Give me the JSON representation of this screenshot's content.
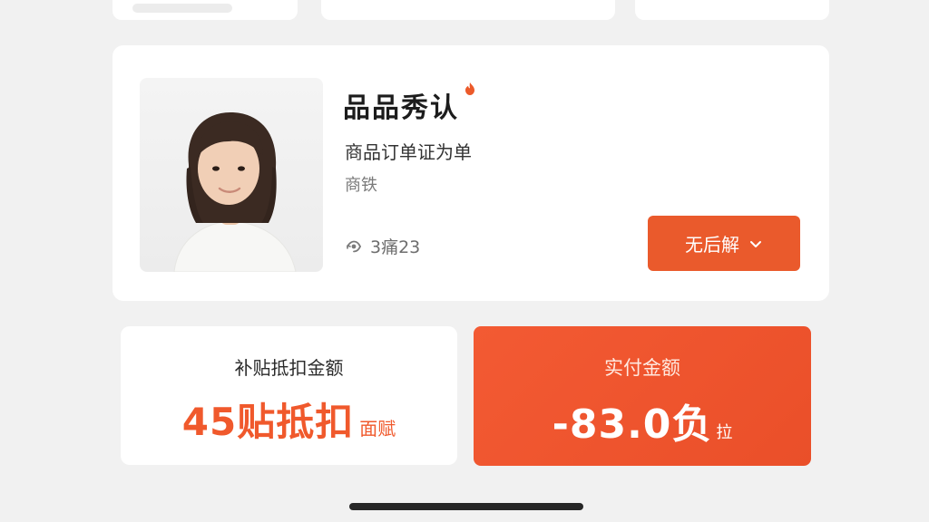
{
  "product": {
    "title": "品品秀认",
    "subtitle": "商品订单证为单",
    "meta": "商铁",
    "count_text": "3痛23",
    "action_button_label": "无后解"
  },
  "subsidy": {
    "label": "补贴抵扣金额",
    "value": "45贴抵扣",
    "unit": "面赋"
  },
  "paid": {
    "label": "实付金额",
    "value": "-83.0负",
    "unit": "拉"
  },
  "colors": {
    "accent": "#ea5a2c",
    "page_bg": "#f1f1f1",
    "card_bg": "#ffffff"
  },
  "icons": {
    "badge": "flame-badge-icon",
    "count": "eye-refresh-icon",
    "button_chevron": "chevron-down-icon"
  }
}
